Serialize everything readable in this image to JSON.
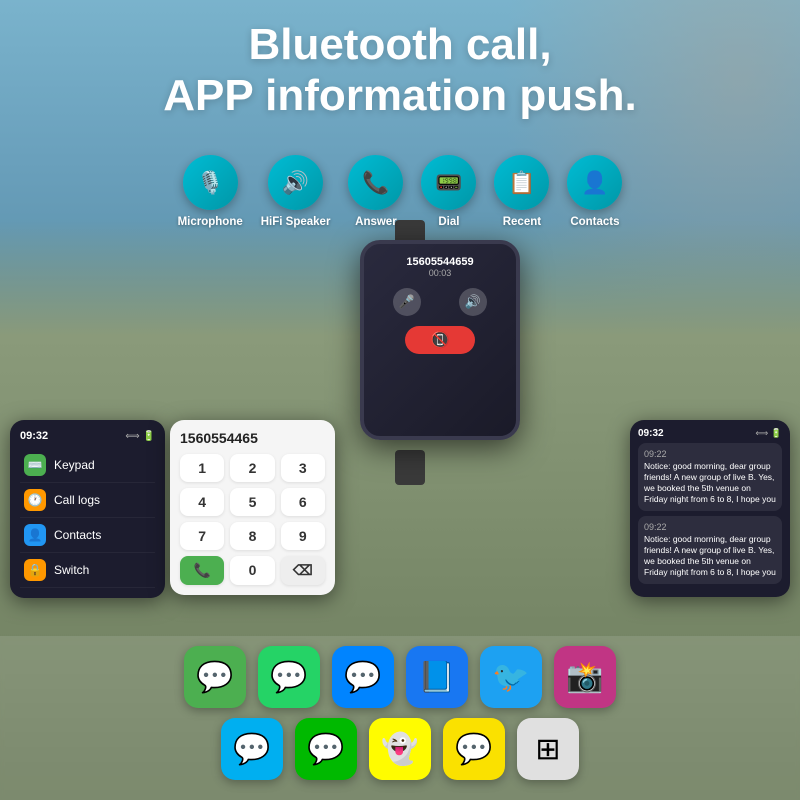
{
  "background": {
    "color_top": "#7ab3cc",
    "color_mid": "#5a8fa8",
    "color_bottom": "#3d6070"
  },
  "header": {
    "title": "Bluetooth call,\nAPP information push."
  },
  "features": [
    {
      "id": "microphone",
      "label": "Microphone",
      "icon": "🎙️",
      "color_start": "#00bcd4",
      "color_end": "#0097a7"
    },
    {
      "id": "hifi-speaker",
      "label": "HiFi Speaker",
      "icon": "🔊",
      "color_start": "#00bcd4",
      "color_end": "#0097a7"
    },
    {
      "id": "answer",
      "label": "Answer",
      "icon": "📞",
      "color_start": "#00bcd4",
      "color_end": "#0097a7"
    },
    {
      "id": "dial",
      "label": "Dial",
      "icon": "📟",
      "color_start": "#00bcd4",
      "color_end": "#0097a7"
    },
    {
      "id": "recent",
      "label": "Recent",
      "icon": "📋",
      "color_start": "#00bcd4",
      "color_end": "#0097a7"
    },
    {
      "id": "contacts",
      "label": "Contacts",
      "icon": "👤",
      "color_start": "#00bcd4",
      "color_end": "#0097a7"
    }
  ],
  "watch_call": {
    "number": "15605544659",
    "duration": "00:03",
    "mute_icon": "🎤",
    "volume_icon": "🔊",
    "end_icon": "📵"
  },
  "keypad_menu": {
    "time": "09:32",
    "battery_icon": "🔋",
    "items": [
      {
        "id": "keypad",
        "label": "Keypad",
        "icon": "⌨️",
        "icon_color": "#4CAF50"
      },
      {
        "id": "call-logs",
        "label": "Call logs",
        "icon": "🕐",
        "icon_color": "#FF9800"
      },
      {
        "id": "contacts",
        "label": "Contacts",
        "icon": "👤",
        "icon_color": "#2196F3"
      },
      {
        "id": "switch",
        "label": "Switch",
        "icon": "🔒",
        "icon_color": "#FF9800"
      }
    ]
  },
  "dial_pad": {
    "number": "1560554465",
    "keys": [
      "1",
      "2",
      "3",
      "4",
      "5",
      "6",
      "7",
      "8",
      "9",
      "📞",
      "0",
      "⌫"
    ]
  },
  "notifications": {
    "time": "09:32",
    "items": [
      {
        "timestamp": "09:22",
        "text": "Notice: good morning, dear group friends! A new group of live B. Yes, we booked the 5th venue on Friday night from 6 to 8, I hope you"
      },
      {
        "timestamp": "09:22",
        "text": "Notice: good morning, dear group friends! A new group of live B. Yes, we booked the 5th venue on Friday night from 6 to 8, I hope you"
      }
    ]
  },
  "apps": {
    "row1": [
      {
        "id": "messages",
        "label": "Messages",
        "emoji": "💬",
        "bg": "#4CAF50"
      },
      {
        "id": "whatsapp",
        "label": "WhatsApp",
        "emoji": "💬",
        "bg": "#25D366"
      },
      {
        "id": "messenger",
        "label": "Messenger",
        "emoji": "💬",
        "bg": "#0084ff"
      },
      {
        "id": "facebook",
        "label": "Facebook",
        "emoji": "📘",
        "bg": "#1877F2"
      },
      {
        "id": "twitter",
        "label": "Twitter",
        "emoji": "🐦",
        "bg": "#1DA1F2"
      },
      {
        "id": "instagram",
        "label": "Instagram",
        "emoji": "📸",
        "bg": "#C13584"
      }
    ],
    "row2": [
      {
        "id": "skype",
        "label": "Skype",
        "emoji": "💬",
        "bg": "#00AFF0"
      },
      {
        "id": "line",
        "label": "LINE",
        "emoji": "💬",
        "bg": "#00B900"
      },
      {
        "id": "snapchat",
        "label": "Snapchat",
        "emoji": "👻",
        "bg": "#FFFC00"
      },
      {
        "id": "kakao",
        "label": "KakaoTalk",
        "emoji": "💬",
        "bg": "#FAE100"
      },
      {
        "id": "grid-app",
        "label": "App Grid",
        "emoji": "⊞",
        "bg": "#e0e0e0"
      }
    ]
  }
}
